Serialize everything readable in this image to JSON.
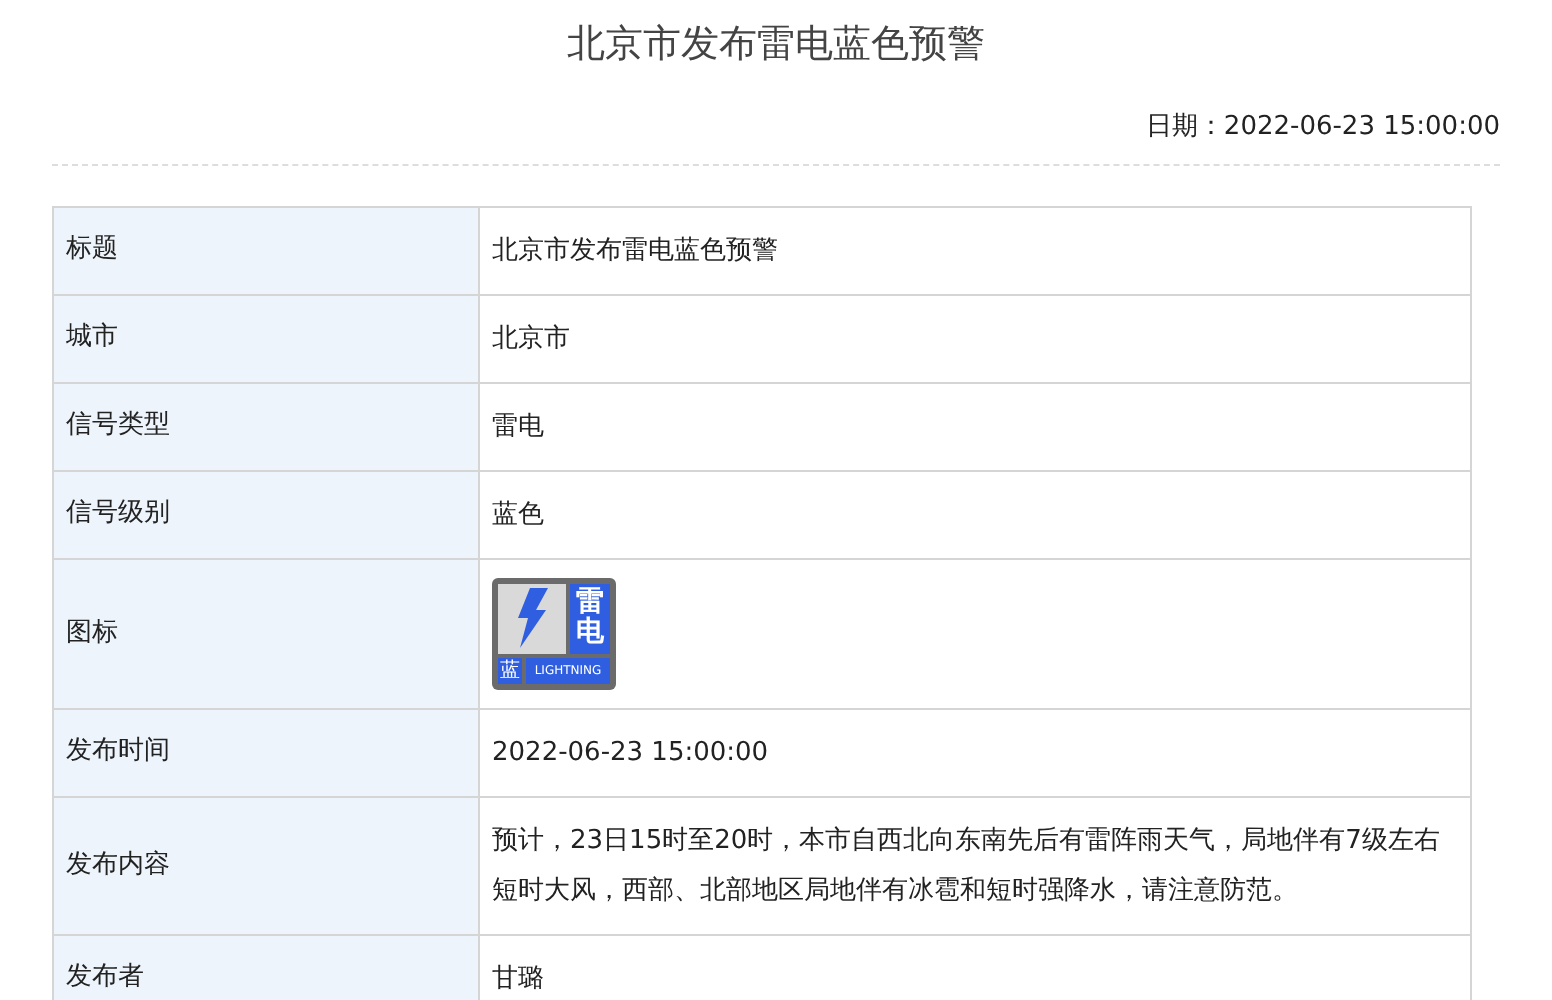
{
  "title": "北京市发布雷电蓝色预警",
  "date": {
    "label": "日期：",
    "value": "2022-06-23 15:00:00"
  },
  "rows": [
    {
      "kind": "text",
      "label": "标题",
      "value": "北京市发布雷电蓝色预警"
    },
    {
      "kind": "text",
      "label": "城市",
      "value": "北京市"
    },
    {
      "kind": "text",
      "label": "信号类型",
      "value": "雷电"
    },
    {
      "kind": "text",
      "label": "信号级别",
      "value": "蓝色"
    },
    {
      "kind": "icon",
      "label": "图标",
      "icon": {
        "characters": [
          "雷",
          "电"
        ],
        "level_char": "蓝",
        "caption": "LIGHTNING"
      }
    },
    {
      "kind": "text",
      "label": "发布时间",
      "value": "2022-06-23 15:00:00"
    },
    {
      "kind": "text",
      "label": "发布内容",
      "value": "预计，23日15时至20时，本市自西北向东南先后有雷阵雨天气，局地伴有7级左右短时大风，西部、北部地区局地伴有冰雹和短时强降水，请注意防范。"
    },
    {
      "kind": "text",
      "label": "发布者",
      "value": "甘璐"
    }
  ]
}
